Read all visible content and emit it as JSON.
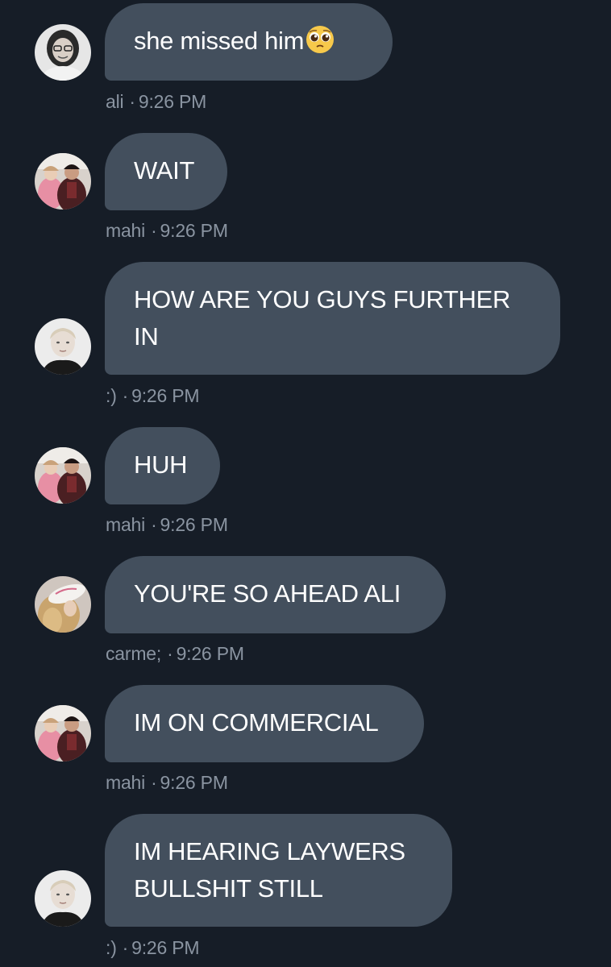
{
  "messages": [
    {
      "text": "she missed him",
      "emoji": "pleading-face",
      "sender": "ali",
      "time": "9:26 PM"
    },
    {
      "text": "WAIT",
      "sender": "mahi",
      "time": "9:26 PM"
    },
    {
      "text_lines": [
        "HOW ARE YOU GUYS FURTHER",
        "IN"
      ],
      "sender": ":)",
      "time": "9:26 PM"
    },
    {
      "text": "HUH",
      "sender": "mahi",
      "time": "9:26 PM"
    },
    {
      "text": "YOU'RE SO AHEAD ALI",
      "sender": "carme;",
      "time": "9:26 PM"
    },
    {
      "text": "IM ON COMMERCIAL",
      "sender": "mahi",
      "time": "9:26 PM"
    },
    {
      "text_lines": [
        "IM HEARING LAYWERS",
        "BULLSHIT STILL"
      ],
      "sender": ":)",
      "time": "9:26 PM"
    }
  ],
  "meta_separator": "·",
  "colors": {
    "background": "#161d27",
    "bubble": "#434f5d",
    "text": "#ffffff",
    "meta": "#8a94a1"
  }
}
